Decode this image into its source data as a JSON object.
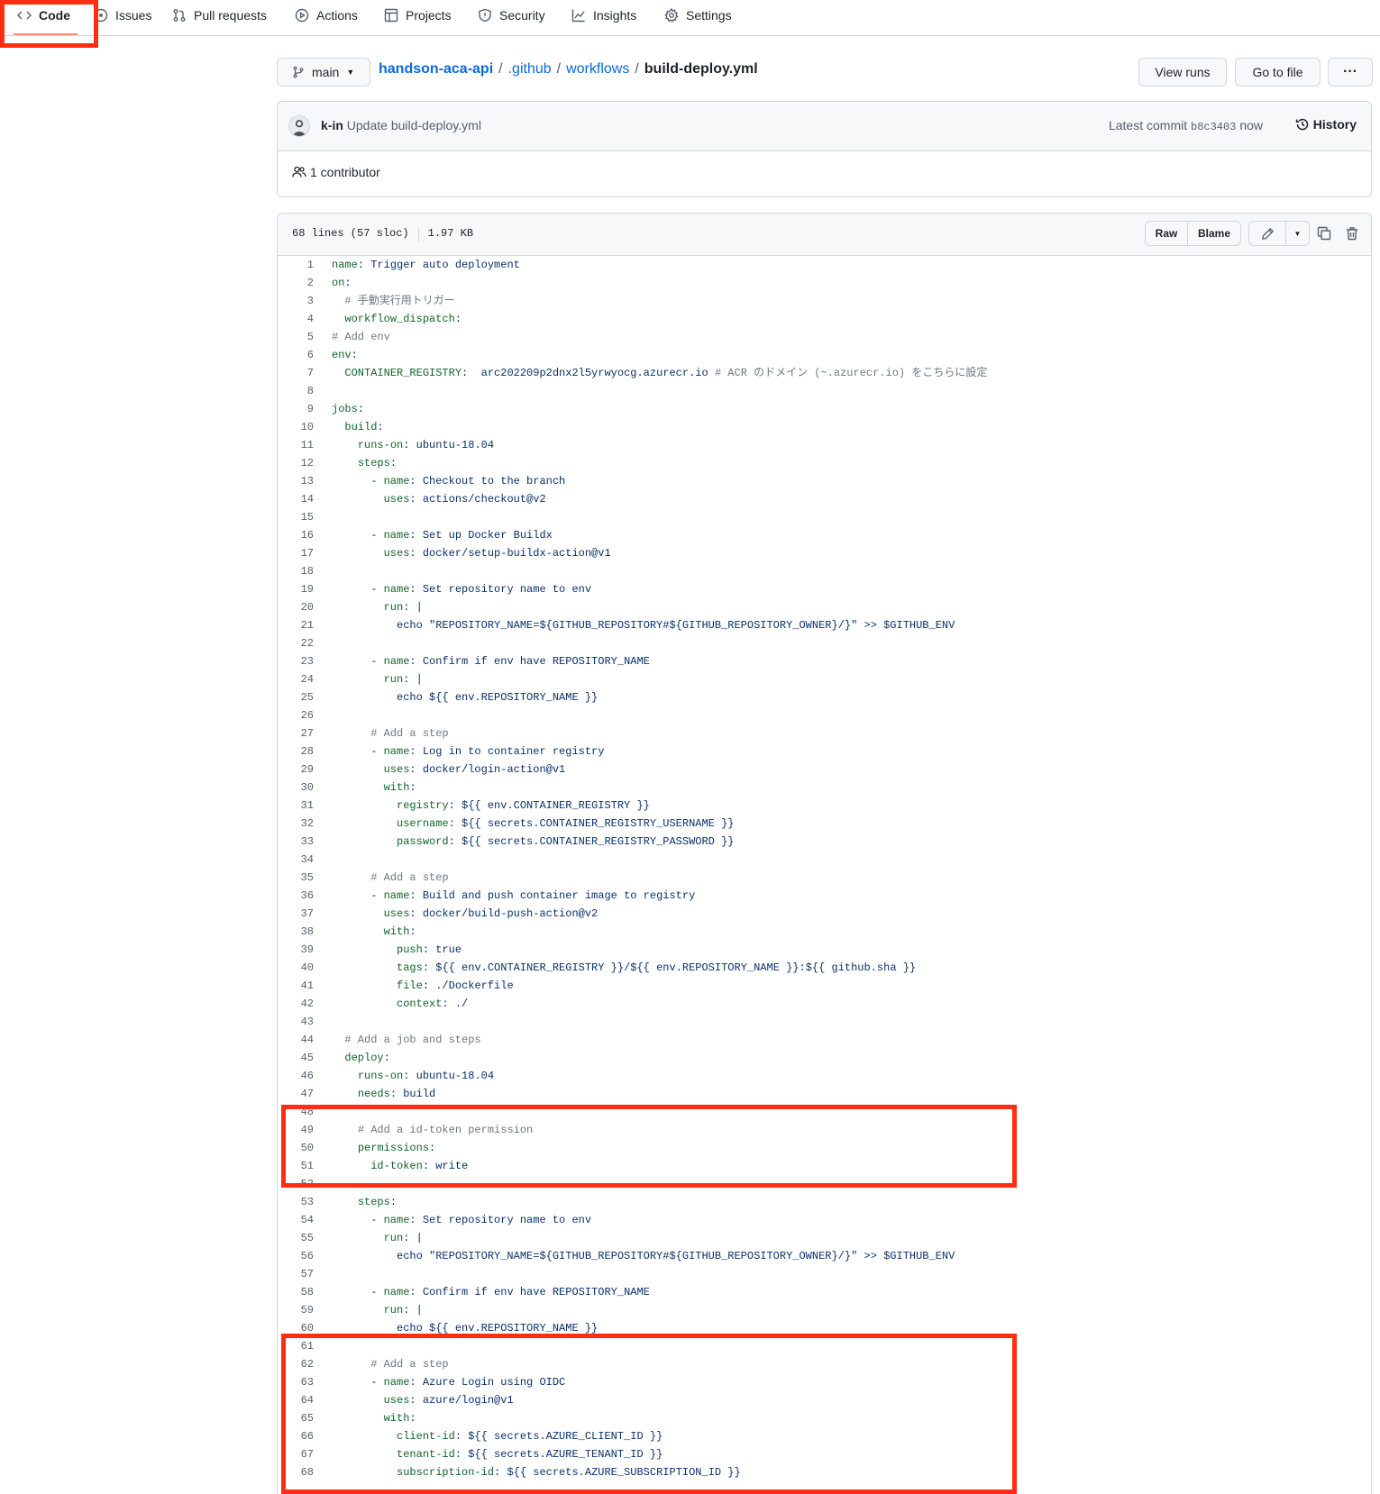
{
  "nav": {
    "tabs": [
      {
        "label": "Code",
        "icon": "code-icon"
      },
      {
        "label": "Issues",
        "icon": "issue-icon"
      },
      {
        "label": "Pull requests",
        "icon": "pull-request-icon"
      },
      {
        "label": "Actions",
        "icon": "play-icon"
      },
      {
        "label": "Projects",
        "icon": "table-icon"
      },
      {
        "label": "Security",
        "icon": "shield-icon"
      },
      {
        "label": "Insights",
        "icon": "graph-icon"
      },
      {
        "label": "Settings",
        "icon": "gear-icon"
      }
    ]
  },
  "branch": {
    "label": "main"
  },
  "breadcrumb": {
    "repo": "handson-aca-api",
    "dir1": ".github",
    "dir2": "workflows",
    "file": "build-deploy.yml",
    "sep": "/"
  },
  "actions": {
    "view_runs": "View runs",
    "go_to_file": "Go to file",
    "more": "···"
  },
  "commit": {
    "author": "k-in",
    "message": "Update build-deploy.yml",
    "latest_label": "Latest commit",
    "sha": "b8c3403",
    "time": "now",
    "history": "History",
    "contributors": "1 contributor"
  },
  "file": {
    "lines_info": "68 lines (57 sloc)",
    "size": "1.97 KB",
    "raw": "Raw",
    "blame": "Blame"
  },
  "highlight_color": "#ff2d12",
  "code_lines": [
    {
      "n": "1",
      "t": "name: Trigger auto deployment"
    },
    {
      "n": "2",
      "t": "on:"
    },
    {
      "n": "3",
      "t": "  # 手動実行用トリガー"
    },
    {
      "n": "4",
      "t": "  workflow_dispatch:"
    },
    {
      "n": "5",
      "t": "# Add env"
    },
    {
      "n": "6",
      "t": "env:"
    },
    {
      "n": "7",
      "t": "  CONTAINER_REGISTRY:  arc202209p2dnx2l5yrwyocg.azurecr.io # ACR のドメイン (~.azurecr.io) をこちらに設定"
    },
    {
      "n": "8",
      "t": ""
    },
    {
      "n": "9",
      "t": "jobs:"
    },
    {
      "n": "10",
      "t": "  build:"
    },
    {
      "n": "11",
      "t": "    runs-on: ubuntu-18.04"
    },
    {
      "n": "12",
      "t": "    steps:"
    },
    {
      "n": "13",
      "t": "      - name: Checkout to the branch"
    },
    {
      "n": "14",
      "t": "        uses: actions/checkout@v2"
    },
    {
      "n": "15",
      "t": ""
    },
    {
      "n": "16",
      "t": "      - name: Set up Docker Buildx"
    },
    {
      "n": "17",
      "t": "        uses: docker/setup-buildx-action@v1"
    },
    {
      "n": "18",
      "t": ""
    },
    {
      "n": "19",
      "t": "      - name: Set repository name to env"
    },
    {
      "n": "20",
      "t": "        run: |"
    },
    {
      "n": "21",
      "t": "          echo \"REPOSITORY_NAME=${GITHUB_REPOSITORY#${GITHUB_REPOSITORY_OWNER}/}\" >> $GITHUB_ENV"
    },
    {
      "n": "22",
      "t": ""
    },
    {
      "n": "23",
      "t": "      - name: Confirm if env have REPOSITORY_NAME"
    },
    {
      "n": "24",
      "t": "        run: |"
    },
    {
      "n": "25",
      "t": "          echo ${{ env.REPOSITORY_NAME }}"
    },
    {
      "n": "26",
      "t": ""
    },
    {
      "n": "27",
      "t": "      # Add a step"
    },
    {
      "n": "28",
      "t": "      - name: Log in to container registry"
    },
    {
      "n": "29",
      "t": "        uses: docker/login-action@v1"
    },
    {
      "n": "30",
      "t": "        with:"
    },
    {
      "n": "31",
      "t": "          registry: ${{ env.CONTAINER_REGISTRY }}"
    },
    {
      "n": "32",
      "t": "          username: ${{ secrets.CONTAINER_REGISTRY_USERNAME }}"
    },
    {
      "n": "33",
      "t": "          password: ${{ secrets.CONTAINER_REGISTRY_PASSWORD }}"
    },
    {
      "n": "34",
      "t": ""
    },
    {
      "n": "35",
      "t": "      # Add a step"
    },
    {
      "n": "36",
      "t": "      - name: Build and push container image to registry"
    },
    {
      "n": "37",
      "t": "        uses: docker/build-push-action@v2"
    },
    {
      "n": "38",
      "t": "        with:"
    },
    {
      "n": "39",
      "t": "          push: true"
    },
    {
      "n": "40",
      "t": "          tags: ${{ env.CONTAINER_REGISTRY }}/${{ env.REPOSITORY_NAME }}:${{ github.sha }}"
    },
    {
      "n": "41",
      "t": "          file: ./Dockerfile"
    },
    {
      "n": "42",
      "t": "          context: ./"
    },
    {
      "n": "43",
      "t": ""
    },
    {
      "n": "44",
      "t": "  # Add a job and steps"
    },
    {
      "n": "45",
      "t": "  deploy:"
    },
    {
      "n": "46",
      "t": "    runs-on: ubuntu-18.04"
    },
    {
      "n": "47",
      "t": "    needs: build"
    },
    {
      "n": "48",
      "t": ""
    },
    {
      "n": "49",
      "t": "    # Add a id-token permission"
    },
    {
      "n": "50",
      "t": "    permissions:"
    },
    {
      "n": "51",
      "t": "      id-token: write"
    },
    {
      "n": "52",
      "t": ""
    },
    {
      "n": "53",
      "t": "    steps:"
    },
    {
      "n": "54",
      "t": "      - name: Set repository name to env"
    },
    {
      "n": "55",
      "t": "        run: |"
    },
    {
      "n": "56",
      "t": "          echo \"REPOSITORY_NAME=${GITHUB_REPOSITORY#${GITHUB_REPOSITORY_OWNER}/}\" >> $GITHUB_ENV"
    },
    {
      "n": "57",
      "t": ""
    },
    {
      "n": "58",
      "t": "      - name: Confirm if env have REPOSITORY_NAME"
    },
    {
      "n": "59",
      "t": "        run: |"
    },
    {
      "n": "60",
      "t": "          echo ${{ env.REPOSITORY_NAME }}"
    },
    {
      "n": "61",
      "t": ""
    },
    {
      "n": "62",
      "t": "      # Add a step"
    },
    {
      "n": "63",
      "t": "      - name: Azure Login using OIDC"
    },
    {
      "n": "64",
      "t": "        uses: azure/login@v1"
    },
    {
      "n": "65",
      "t": "        with:"
    },
    {
      "n": "66",
      "t": "          client-id: ${{ secrets.AZURE_CLIENT_ID }}"
    },
    {
      "n": "67",
      "t": "          tenant-id: ${{ secrets.AZURE_TENANT_ID }}"
    },
    {
      "n": "68",
      "t": "          subscription-id: ${{ secrets.AZURE_SUBSCRIPTION_ID }}"
    }
  ]
}
